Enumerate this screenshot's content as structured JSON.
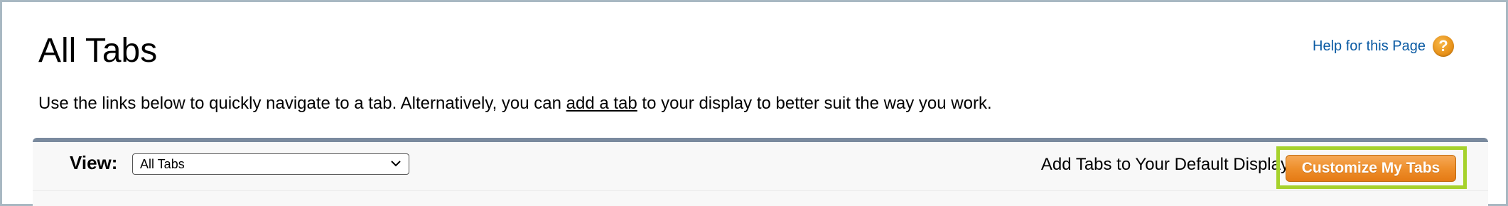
{
  "page": {
    "title": "All Tabs",
    "help_link": "Help for this Page",
    "help_icon": "question-mark-icon"
  },
  "intro": {
    "before_link": "Use the links below to quickly navigate to a tab. Alternatively, you can ",
    "link": "add a tab",
    "after_link": " to your display to better suit the way you work."
  },
  "view_bar": {
    "view_label": "View:",
    "selected_view": "All Tabs",
    "add_tabs_text": "Add Tabs to Your Default Display",
    "customize_button": "Customize My Tabs"
  },
  "colors": {
    "accent_highlight": "#a6d22c",
    "button_orange": "#ee8f2c",
    "link_blue": "#0a5aa3",
    "bar_border": "#7a8a9e"
  }
}
